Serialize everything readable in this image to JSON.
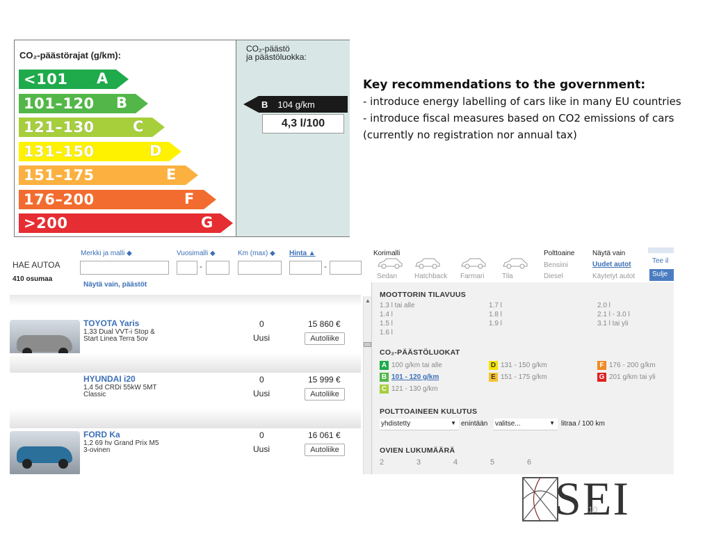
{
  "energy_label": {
    "title": "CO₂-päästörajat (g/km):",
    "classes": [
      {
        "range": "<101",
        "letter": "A",
        "color": "#1faa4b"
      },
      {
        "range": "101–120",
        "letter": "B",
        "color": "#52b748"
      },
      {
        "range": "121–130",
        "letter": "C",
        "color": "#a6cf3b"
      },
      {
        "range": "131–150",
        "letter": "D",
        "color": "#fff200"
      },
      {
        "range": "151–175",
        "letter": "E",
        "color": "#fbb040"
      },
      {
        "range": "176–200",
        "letter": "F",
        "color": "#f26c2f"
      },
      {
        "range": ">200",
        "letter": "G",
        "color": "#e52d32"
      }
    ],
    "right_title_line1": "CO₂-päästö",
    "right_title_line2": "ja päästöluokka:",
    "indicator_class": "B",
    "indicator_value": "104 g/km",
    "consumption": "4,3 l/100"
  },
  "key": {
    "heading": "Key recommendations to the government:",
    "line1": "- introduce energy labelling of cars like in many EU countries",
    "line2": "- introduce fiscal measures based on CO2 emissions of cars (currently no registration nor annual tax)"
  },
  "search": {
    "title": "HAE AUTOA",
    "results": "410 osumaa",
    "col_make": "Merkki ja malli ◆",
    "col_year": "Vuosimalli ◆",
    "col_km": "Km (max) ◆",
    "col_price": "Hinta ▲",
    "dash1": "-",
    "dash2": "-",
    "show_only": "Näytä vain, päästöt",
    "body_label": "Korimalli",
    "bodies": [
      "Sedan",
      "Hatchback",
      "Farmari",
      "Tila"
    ],
    "fuel_label": "Polttoaine",
    "fuels": [
      "Bensiini",
      "Diesel"
    ],
    "show_label": "Näytä vain",
    "show_new": "Uudet autot",
    "show_used": "Käytetyt autot",
    "tee_btn": "Tee il",
    "close_btn": "Sulje"
  },
  "cars": [
    {
      "name": "TOYOTA Yaris",
      "desc1": "1,33 Dual VVT-i Stop &",
      "desc2": "Start Linea Terra 5ov",
      "km": "0",
      "cond": "Uusi",
      "price": "15 860 €",
      "btn": "Autoliike",
      "color": "#8c8c8c"
    },
    {
      "name": "HYUNDAI i20",
      "desc1": "1,4 5d CRDi 55kW 5MT",
      "desc2": "Classic",
      "km": "0",
      "cond": "Uusi",
      "price": "15 999 €",
      "btn": "Autoliike",
      "color": ""
    },
    {
      "name": "FORD Ka",
      "desc1": "1,2 69 hv Grand Prix M5",
      "desc2": "3-ovinen",
      "km": "0",
      "cond": "Uusi",
      "price": "16 061 €",
      "btn": "Autoliike",
      "color": "#2b6f9b"
    }
  ],
  "panel": {
    "engine_title": "MOOTTORIN TILAVUUS",
    "engine_col1": [
      "1.3 l tai alle",
      "1.4 l",
      "1.5 l",
      "1.6 l"
    ],
    "engine_col2": [
      "1.7 l",
      "1.8 l",
      "1.9 l"
    ],
    "engine_col3": [
      "2.0 l",
      "2.1 l - 3.0 l",
      "3.1 l tai yli"
    ],
    "co2_title": "CO₂-PÄÄSTÖLUOKAT",
    "co2": [
      {
        "letter": "A",
        "text": "100 g/km tai alle",
        "color": "#1faa4b"
      },
      {
        "letter": "B",
        "text": "101 - 120 g/km",
        "color": "#52b748"
      },
      {
        "letter": "C",
        "text": "121 - 130 g/km",
        "color": "#a6cf3b"
      },
      {
        "letter": "D",
        "text": "131 - 150 g/km",
        "color": "#f5e400"
      },
      {
        "letter": "E",
        "text": "151 - 175 g/km",
        "color": "#f7c230"
      },
      {
        "letter": "F",
        "text": "176 - 200 g/km",
        "color": "#f08a24"
      },
      {
        "letter": "G",
        "text": "201 g/km tai yli",
        "color": "#e02020"
      }
    ],
    "fuel_title": "POLTTOAINEEN KULUTUS",
    "fuel_select": "yhdistetty",
    "fuel_max": "enintään",
    "fuel_choose": "valitse...",
    "fuel_unit": "litraa / 100 km",
    "doors_title": "OVIEN LUKUMÄÄRÄ",
    "doors": [
      "2",
      "3",
      "4",
      "5",
      "6"
    ]
  },
  "logo": {
    "text": "SEI",
    "page": "10"
  }
}
